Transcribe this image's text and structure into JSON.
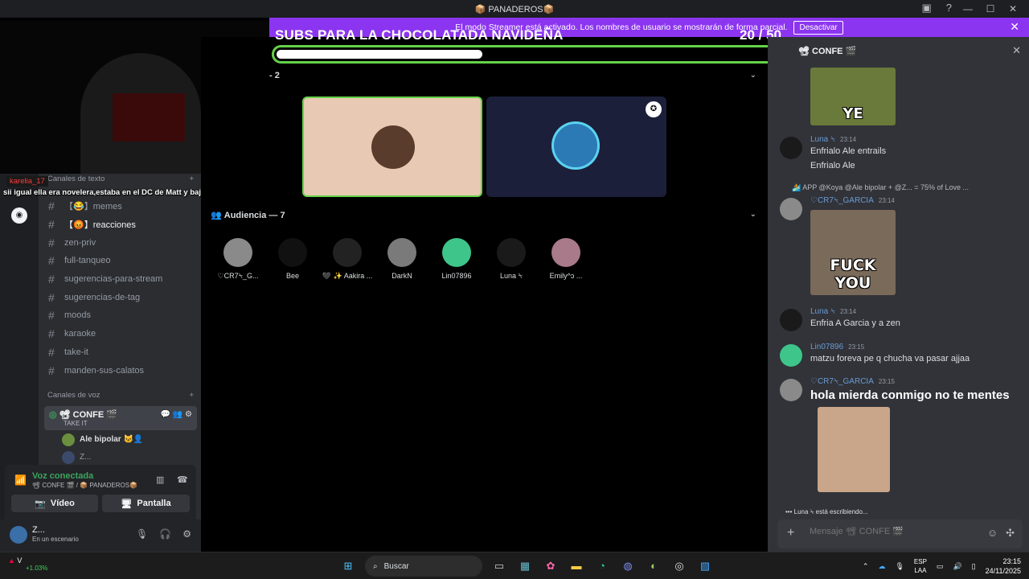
{
  "titlebar": {
    "title": "📦 PANADEROS📦",
    "minimize": "—",
    "maximize": "☐",
    "close": "✕"
  },
  "streamer_banner": {
    "text": "El modo Streamer está activado. Los nombres de usuario se mostrarán de forma parcial.",
    "button": "Desactivar"
  },
  "overlay": {
    "goal_title": "SUBS PARA LA CHOCOLATADA NAVIDEÑA",
    "goal_count": "20  / 50",
    "goal_progress": 0.4,
    "chat_user": "karelia_17",
    "chat_msg": "sii igual ella era novelera,estaba en el DC de Matt y baja pepa pero a hora ya no"
  },
  "sidebar": {
    "text_category": "Canales de texto",
    "channels": [
      {
        "name": "【😂】memes",
        "bold": false
      },
      {
        "name": "【😡】reacciones",
        "bold": true
      },
      {
        "name": "zen-priv",
        "bold": false
      },
      {
        "name": "full-tanqueo",
        "bold": false
      },
      {
        "name": "sugerencias-para-stream",
        "bold": false
      },
      {
        "name": "sugerencias-de-tag",
        "bold": false
      },
      {
        "name": "moods",
        "bold": false
      },
      {
        "name": "karaoke",
        "bold": false
      },
      {
        "name": "take-it",
        "bold": false
      },
      {
        "name": "manden-sus-calatos",
        "bold": false
      }
    ],
    "voice_category": "Canales de voz",
    "voice_channel": {
      "name": "📽 CONFE 🎬",
      "sub": "TAKE IT"
    },
    "voice_users": [
      "Ale bipolar 🐱‍👤",
      "Z..."
    ]
  },
  "voice_panel": {
    "status": "Voz conectada",
    "location": "📽 CONFE 🎬 / 📦 PANADEROS📦",
    "video_label": "Vídeo",
    "screen_label": "Pantalla"
  },
  "user_panel": {
    "name": "Z...",
    "status": "En un escenario"
  },
  "stage": {
    "speakers_header": "- 2",
    "audience_header": "Audiencia — 7",
    "audience": [
      {
        "name": "♡CR7⍀_G...",
        "color": "#8a8a8a"
      },
      {
        "name": "Bee",
        "color": "#111111"
      },
      {
        "name": "🖤 ✨ Aakira ...",
        "color": "#222222"
      },
      {
        "name": "DarkN",
        "color": "#7a7a7a"
      },
      {
        "name": "Lin07896",
        "color": "#3ec58a"
      },
      {
        "name": "Luna ⍀",
        "color": "#1a1a1a"
      },
      {
        "name": "Emily^ↄ ...",
        "color": "#a87a8a"
      }
    ]
  },
  "chat": {
    "channel": "📽 CONFE 🎬",
    "messages": [
      {
        "user": "Luna ⍀",
        "time": "23:14",
        "lines": [
          "Enfrialo Ale entrails",
          "Enfrialo Ale"
        ]
      },
      {
        "reply": "🏄 APP @Koya @Ale bipolar + @Z... = 75% of Love ...",
        "user": "♡CR7⍀_GARCIA",
        "time": "23:14",
        "meme": "FUCK YOU"
      },
      {
        "user": "Luna ⍀",
        "time": "23:14",
        "lines": [
          "Enfria A Garcia y a zen"
        ]
      },
      {
        "user": "Lin07896",
        "time": "23:15",
        "lines": [
          "matzu foreva pe q chucha va pasar ajjaa"
        ]
      },
      {
        "user": "♡CR7⍀_GARCIA",
        "time": "23:15",
        "big": "hola mierda conmigo no te mentes"
      }
    ],
    "top_meme": "YE",
    "typing": "Luna ⍀ está escribiendo...",
    "composer_placeholder": "Mensaje 📽 CONFE 🎬"
  },
  "taskbar": {
    "weather_label": "V",
    "weather_change": "+1.03%",
    "search_placeholder": "Buscar",
    "lang_top": "ESP",
    "lang_bottom": "LAA",
    "time": "23:15",
    "date": "24/11/2025"
  }
}
